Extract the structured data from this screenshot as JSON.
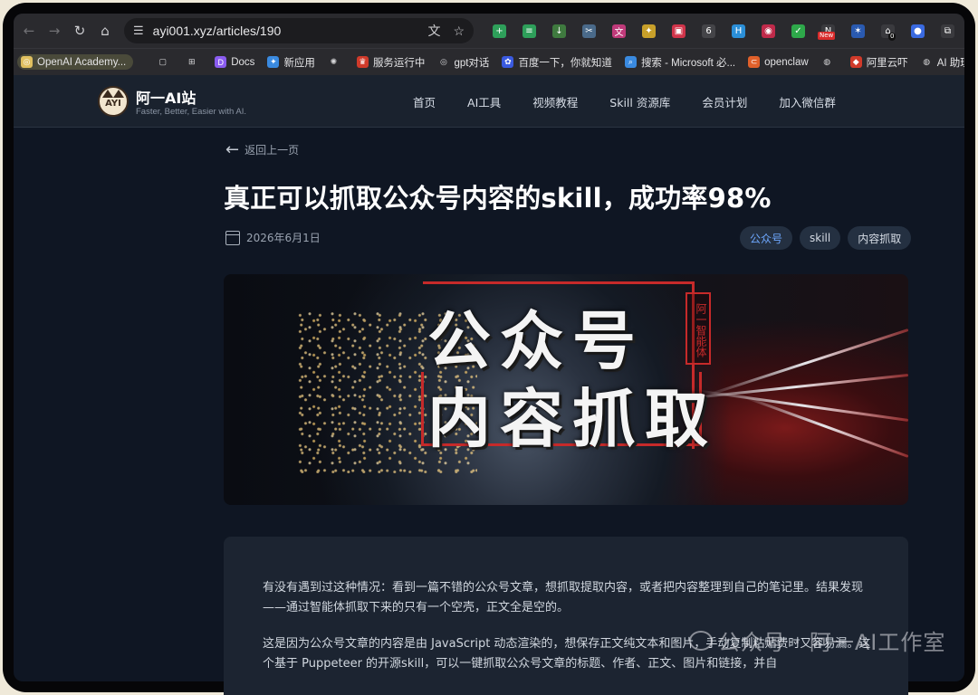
{
  "browser": {
    "url": "ayi001.xyz/articles/190",
    "extensions_badge_new": "New",
    "extensions_badge_count": "0",
    "extensions": [
      {
        "icon": "add-ext-icon",
        "color": "#2e9f5a"
      },
      {
        "icon": "layers-ext-icon",
        "color": "#2e9f5a"
      },
      {
        "icon": "download-ext-icon",
        "color": "#3f7a3f"
      },
      {
        "icon": "scissors-ext-icon",
        "color": "#4a6a8a"
      },
      {
        "icon": "translate-ext-icon",
        "color": "#c03a7a"
      },
      {
        "icon": "bird-ext-icon",
        "color": "#c8a02a"
      },
      {
        "icon": "tv-ext-icon",
        "color": "#d0344a"
      },
      {
        "icon": "ai-ext-icon",
        "color": "#444448"
      },
      {
        "icon": "ai-h-ext-icon",
        "color": "#2b8fd8"
      },
      {
        "icon": "camera-ext-icon",
        "color": "#c02a4a"
      },
      {
        "icon": "check-ext-icon",
        "color": "#2ea84a"
      },
      {
        "icon": "new-ext-icon",
        "color": "#3a3a3e"
      },
      {
        "icon": "bird2-ext-icon",
        "color": "#2a5ab0"
      },
      {
        "icon": "home-ext-icon",
        "color": "#3a3a3e"
      },
      {
        "icon": "dot-ext-icon",
        "color": "#3a6ae0"
      },
      {
        "icon": "puzzle-ext-icon",
        "color": "#3a3a3e"
      }
    ],
    "bookmarks": [
      {
        "label": "OpenAI Academy...",
        "icon": "openai-icon",
        "color": "#e0c060"
      },
      {
        "label": "",
        "icon": "page-icon",
        "color": "#d8d8da"
      },
      {
        "label": "",
        "icon": "apps-grid-icon",
        "color": "#d8d8da"
      },
      {
        "label": "Docs",
        "icon": "docs-icon",
        "color": "#8a5cf0"
      },
      {
        "label": "新应用",
        "icon": "new-app-icon",
        "color": "#3a8ae0"
      },
      {
        "label": "",
        "icon": "openai-logo-icon",
        "color": "#d8d8da"
      },
      {
        "label": "服务运行中",
        "icon": "service-icon",
        "color": "#d03a2a"
      },
      {
        "label": "gpt对话",
        "icon": "chatgpt-icon",
        "color": "#d8d8da"
      },
      {
        "label": "百度一下，你就知道",
        "icon": "baidu-icon",
        "color": "#3a5ae0"
      },
      {
        "label": "搜索 - Microsoft 必...",
        "icon": "search-icon",
        "color": "#3a8ae0"
      },
      {
        "label": "openclaw",
        "icon": "openclaw-icon",
        "color": "#e0602a"
      },
      {
        "label": "",
        "icon": "globe-icon",
        "color": "#d8d8da"
      },
      {
        "label": "阿里云吓",
        "icon": "aliyun-icon",
        "color": "#d03a2a"
      },
      {
        "label": "AI 助理",
        "icon": "ai-assistant-icon",
        "color": "#d8d8da"
      },
      {
        "label": "",
        "icon": "translate-bm-icon",
        "color": "#3a6ae0"
      }
    ]
  },
  "site": {
    "logo_text": "AYI",
    "name": "阿一AI站",
    "tagline": "Faster, Better, Easier with AI.",
    "nav": [
      "首页",
      "AI工具",
      "视频教程",
      "Skill 资源库",
      "会员计划",
      "加入微信群"
    ]
  },
  "article": {
    "back_label": "返回上一页",
    "title": "真正可以抓取公众号内容的skill，成功率98%",
    "date": "2026年6月1日",
    "tags": [
      "公众号",
      "skill",
      "内容抓取"
    ],
    "hero_line1": "公众号",
    "hero_line2": "内容抓取",
    "hero_seal": "阿一智能体",
    "paragraphs": [
      "有没有遇到过这种情况：看到一篇不错的公众号文章，想抓取提取内容，或者把内容整理到自己的笔记里。结果发现——通过智能体抓取下来的只有一个空壳，正文全是空的。",
      "这是因为公众号文章的内容是由 JavaScript 动态渲染的，想保存正文纯文本和图片，手动复制粘贴费时又容易漏。这个基于 Puppeteer 的开源skill，可以一键抓取公众号文章的标题、作者、正文、图片和链接，并自"
    ]
  },
  "watermark": "公众号 · 阿一AI工作室"
}
